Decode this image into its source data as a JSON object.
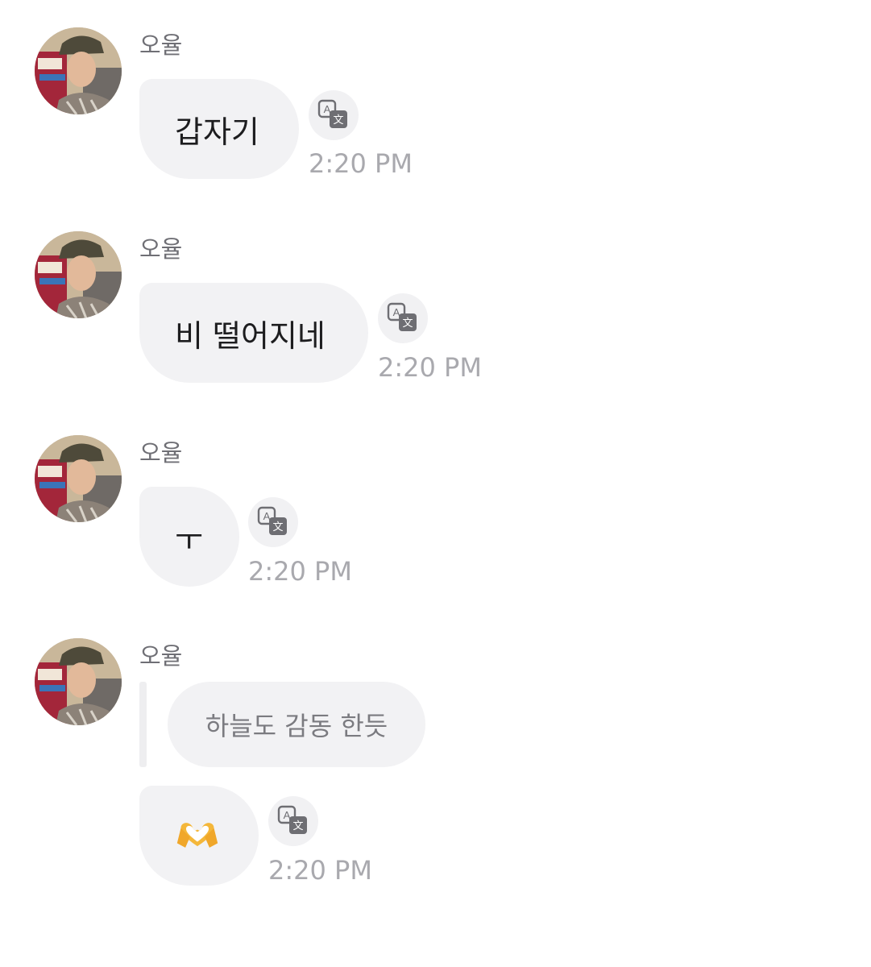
{
  "messages": [
    {
      "sender": "오율",
      "text": "갑자기",
      "time": "2:20 PM",
      "translate_icon": "translate-icon"
    },
    {
      "sender": "오율",
      "text": "비 떨어지네",
      "time": "2:20 PM",
      "translate_icon": "translate-icon"
    },
    {
      "sender": "오율",
      "text": "ㅜ",
      "time": "2:20 PM",
      "translate_icon": "translate-icon"
    },
    {
      "sender": "오율",
      "quote": "하늘도 감동 한듯",
      "text": "🫶",
      "time": "2:20 PM",
      "translate_icon": "translate-icon"
    }
  ],
  "colors": {
    "bubble": "#f2f2f4",
    "sender_text": "#6f6f75",
    "time_text": "#a9a9ae",
    "heart_hands": "#f4b73a"
  }
}
